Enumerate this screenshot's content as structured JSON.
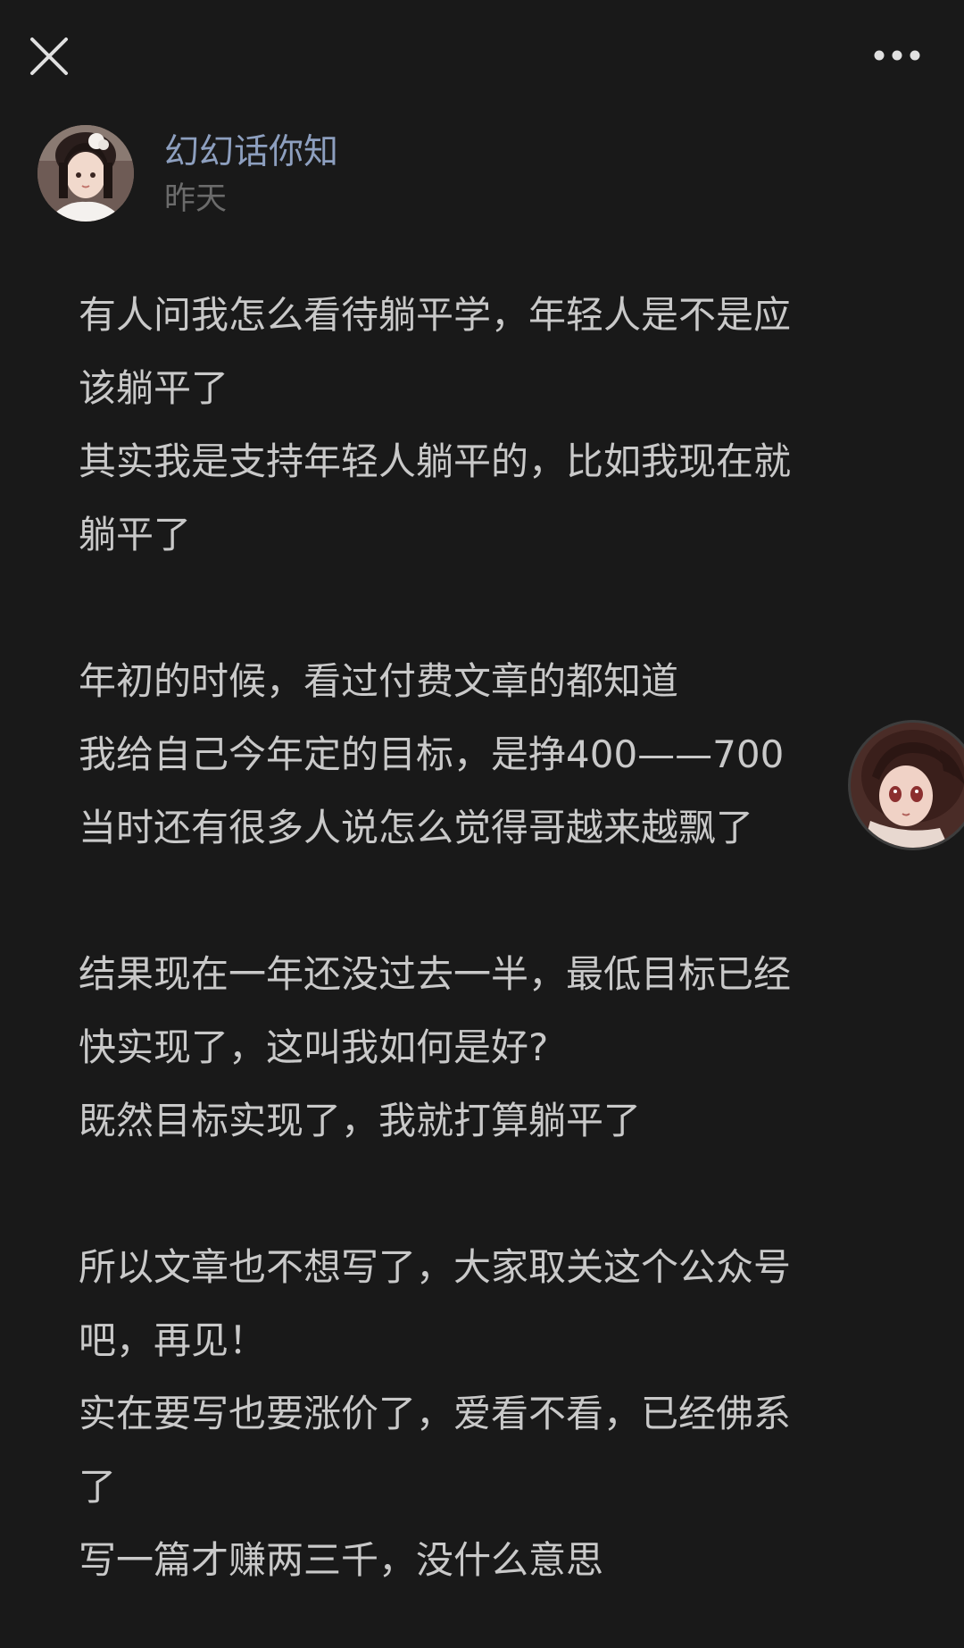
{
  "author": {
    "name": "幻幻话你知",
    "time": "昨天"
  },
  "lines": [
    "有人问我怎么看待躺平学，年轻人是不是应",
    "该躺平了",
    "其实我是支持年轻人躺平的，比如我现在就",
    "躺平了",
    "",
    "年初的时候，看过付费文章的都知道",
    "我给自己今年定的目标，是挣400——700",
    "当时还有很多人说怎么觉得哥越来越飘了",
    "",
    "结果现在一年还没过去一半，最低目标已经",
    "快实现了，这叫我如何是好?",
    "既然目标实现了，我就打算躺平了",
    "",
    "所以文章也不想写了，大家取关这个公众号",
    "吧，再见！",
    "实在要写也要涨价了，爱看不看，已经佛系",
    "了",
    "写一篇才赚两三千，没什么意思"
  ],
  "icons": {
    "close": "close-icon",
    "more": "more-dots-icon"
  },
  "colors": {
    "background": "#191919",
    "author_name": "#8d9fbf",
    "time": "#6b6b6b",
    "body_text": "#c9c9c9",
    "icon": "#e0e0e0"
  }
}
